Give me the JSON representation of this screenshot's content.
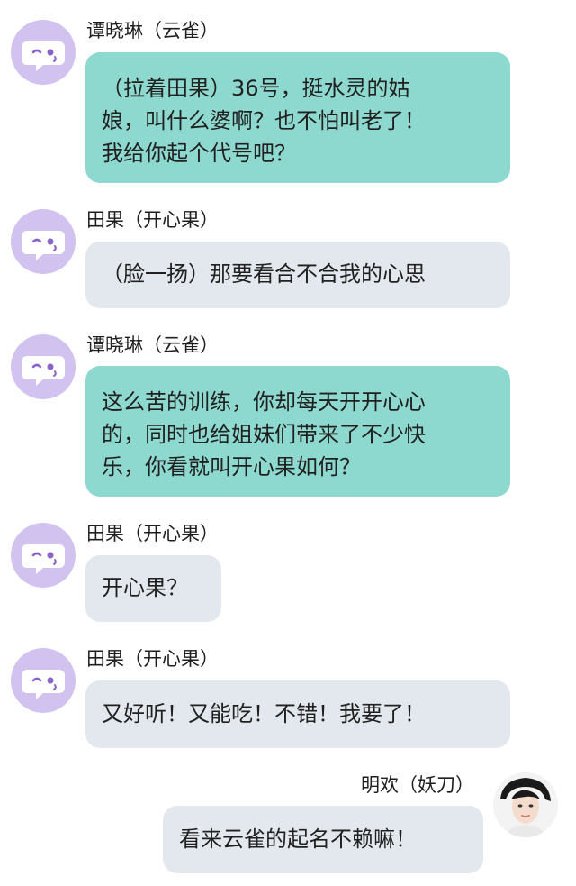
{
  "messages": [
    {
      "sender": "谭晓琳（云雀）",
      "lines": [
        "（拉着田果）36号，挺水灵的姑",
        "娘，叫什么婆啊？也不怕叫老了！",
        "我给你起个代号吧？"
      ],
      "bubble_color": "#8ed9cf",
      "side": "left"
    },
    {
      "sender": "田果（开心果）",
      "lines": [
        "（脸一扬）那要看合不合我的心思"
      ],
      "bubble_color": "#e3e8ee",
      "side": "left"
    },
    {
      "sender": "谭晓琳（云雀）",
      "lines": [
        "这么苦的训练，你却每天开开心心",
        "的，同时也给姐妹们带来了不少快",
        "乐，你看就叫开心果如何？"
      ],
      "bubble_color": "#8ed9cf",
      "side": "left"
    },
    {
      "sender": "田果（开心果）",
      "lines": [
        "开心果？"
      ],
      "bubble_color": "#e3e8ee",
      "side": "left"
    },
    {
      "sender": "田果（开心果）",
      "lines": [
        "又好听！又能吃！不错！我要了！"
      ],
      "bubble_color": "#e3e8ee",
      "side": "left"
    },
    {
      "sender": "明欢（妖刀）",
      "lines": [
        "看来云雀的起名不赖嘛！"
      ],
      "bubble_color": "#e3e8ee",
      "side": "right"
    }
  ],
  "icons": {
    "left_avatar": "chat-bubble-wink-avatar-icon",
    "right_avatar": "profile-photo-avatar"
  },
  "colors": {
    "avatar_bg": "#d2c2f0",
    "teal_bubble": "#8ed9cf",
    "gray_bubble": "#e3e8ee"
  }
}
